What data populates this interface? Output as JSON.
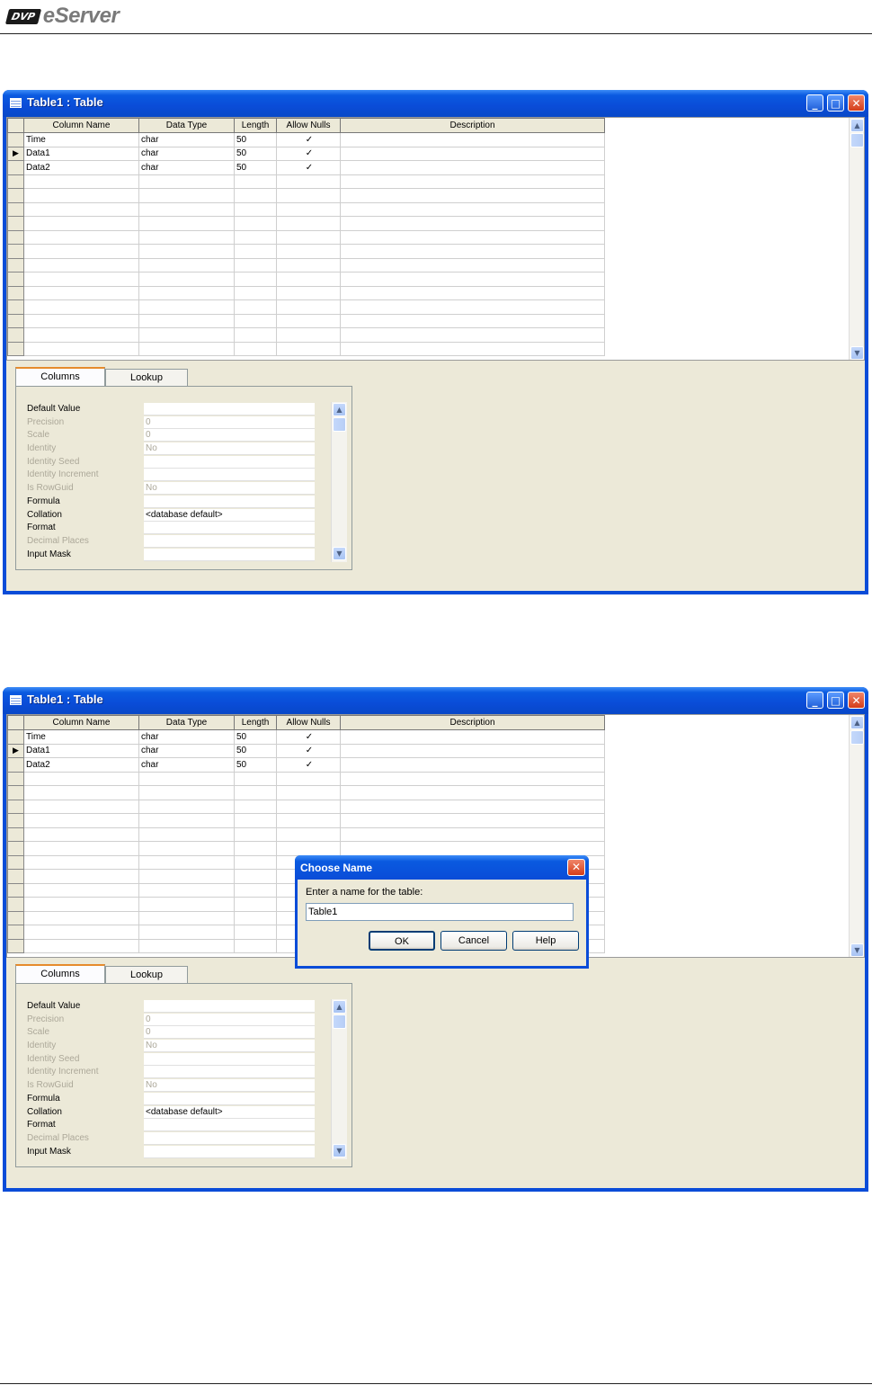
{
  "header": {
    "brand_badge": "DVP",
    "brand_name": "eServer"
  },
  "windows": [
    {
      "title": "Table1 : Table",
      "columns": [
        "Column Name",
        "Data Type",
        "Length",
        "Allow Nulls",
        "Description"
      ],
      "rows": [
        {
          "name": "Time",
          "type": "char",
          "length": "50",
          "allow_nulls": "✓"
        },
        {
          "name": "Data1",
          "type": "char",
          "length": "50",
          "allow_nulls": "✓"
        },
        {
          "name": "Data2",
          "type": "char",
          "length": "50",
          "allow_nulls": "✓"
        }
      ],
      "current_row": 1,
      "tabs": [
        "Columns",
        "Lookup"
      ],
      "active_tab": "Columns",
      "properties": [
        {
          "label": "Default Value",
          "value": "",
          "enabled": true
        },
        {
          "label": "Precision",
          "value": "0",
          "enabled": false
        },
        {
          "label": "Scale",
          "value": "0",
          "enabled": false
        },
        {
          "label": "Identity",
          "value": "No",
          "enabled": false
        },
        {
          "label": "Identity Seed",
          "value": "",
          "enabled": false
        },
        {
          "label": "Identity Increment",
          "value": "",
          "enabled": false
        },
        {
          "label": "Is RowGuid",
          "value": "No",
          "enabled": false
        },
        {
          "label": "Formula",
          "value": "",
          "enabled": true
        },
        {
          "label": "Collation",
          "value": "<database default>",
          "enabled": true
        },
        {
          "label": "Format",
          "value": "",
          "enabled": true
        },
        {
          "label": "Decimal Places",
          "value": "",
          "enabled": false
        },
        {
          "label": "Input Mask",
          "value": "",
          "enabled": true
        }
      ]
    },
    {
      "title": "Table1 : Table",
      "columns": [
        "Column Name",
        "Data Type",
        "Length",
        "Allow Nulls",
        "Description"
      ],
      "rows": [
        {
          "name": "Time",
          "type": "char",
          "length": "50",
          "allow_nulls": "✓"
        },
        {
          "name": "Data1",
          "type": "char",
          "length": "50",
          "allow_nulls": "✓"
        },
        {
          "name": "Data2",
          "type": "char",
          "length": "50",
          "allow_nulls": "✓"
        }
      ],
      "current_row": 1,
      "tabs": [
        "Columns",
        "Lookup"
      ],
      "active_tab": "Columns",
      "properties": [
        {
          "label": "Default Value",
          "value": "",
          "enabled": true
        },
        {
          "label": "Precision",
          "value": "0",
          "enabled": false
        },
        {
          "label": "Scale",
          "value": "0",
          "enabled": false
        },
        {
          "label": "Identity",
          "value": "No",
          "enabled": false
        },
        {
          "label": "Identity Seed",
          "value": "",
          "enabled": false
        },
        {
          "label": "Identity Increment",
          "value": "",
          "enabled": false
        },
        {
          "label": "Is RowGuid",
          "value": "No",
          "enabled": false
        },
        {
          "label": "Formula",
          "value": "",
          "enabled": true
        },
        {
          "label": "Collation",
          "value": "<database default>",
          "enabled": true
        },
        {
          "label": "Format",
          "value": "",
          "enabled": true
        },
        {
          "label": "Decimal Places",
          "value": "",
          "enabled": false
        },
        {
          "label": "Input Mask",
          "value": "",
          "enabled": true
        }
      ]
    }
  ],
  "dialog": {
    "title": "Choose Name",
    "prompt": "Enter a name for the table:",
    "value": "Table1",
    "buttons": {
      "ok": "OK",
      "cancel": "Cancel",
      "help": "Help"
    }
  },
  "icons": {
    "window": "table-icon",
    "minimize": "minimize-icon",
    "maximize": "maximize-icon",
    "close": "close-icon",
    "row_pointer": "row-pointer-icon"
  },
  "colors": {
    "titlebar": "#0a4cd8",
    "face": "#ece9d8",
    "close": "#d43d19"
  }
}
